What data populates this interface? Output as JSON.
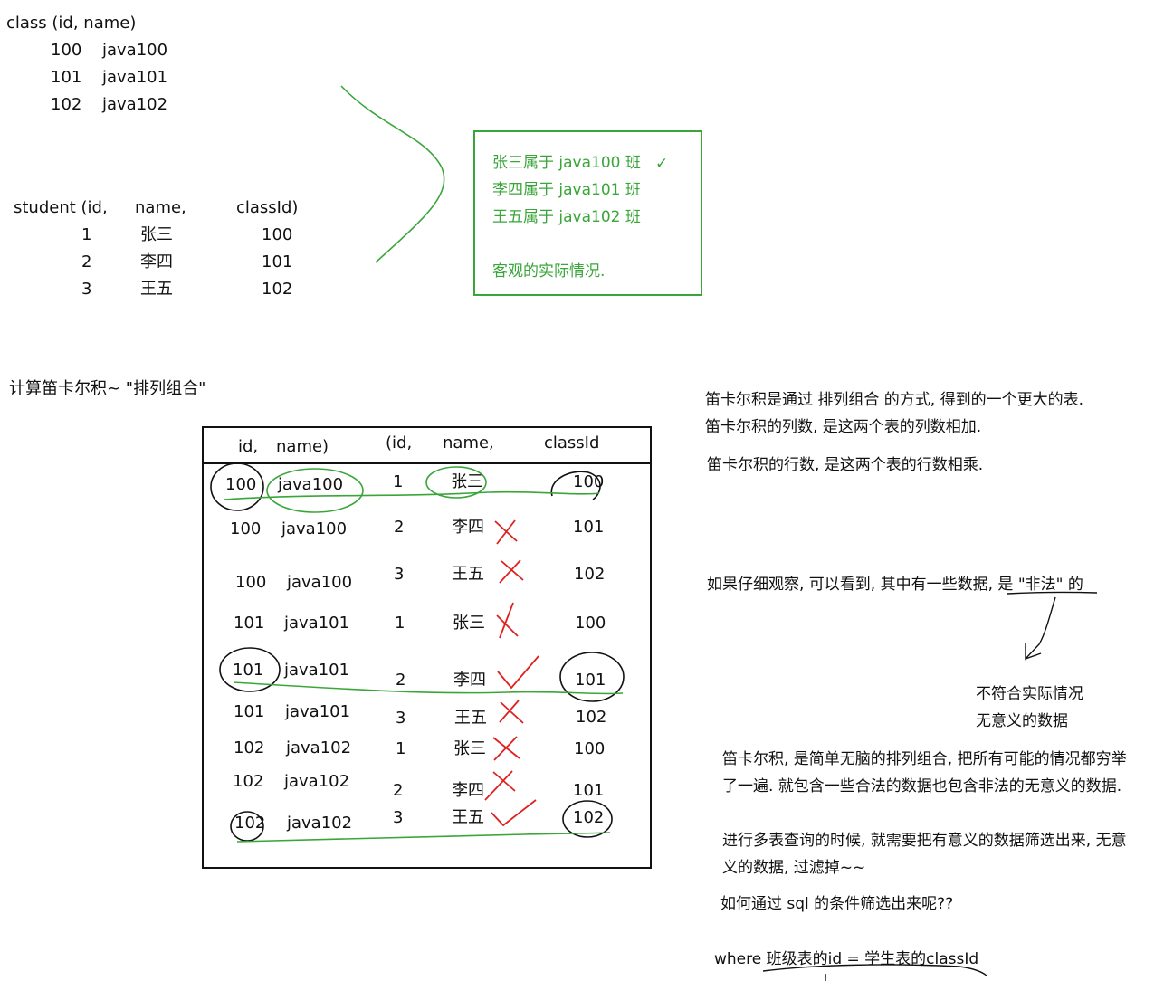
{
  "class_table": {
    "header": "class (id,     name)",
    "rows": [
      {
        "id": "100",
        "name": "java100"
      },
      {
        "id": "101",
        "name": "java101"
      },
      {
        "id": "102",
        "name": "java102"
      }
    ]
  },
  "student_table": {
    "header": "student (id,",
    "header_name": "name,",
    "header_classid": "classId)",
    "rows": [
      {
        "id": "1",
        "name": "张三",
        "classId": "100"
      },
      {
        "id": "2",
        "name": "李四",
        "classId": "101"
      },
      {
        "id": "3",
        "name": "王五",
        "classId": "102"
      }
    ]
  },
  "relation_box": {
    "lines": [
      "张三属于 java100 班",
      "李四属于 java101 班",
      "王五属于 java102 班"
    ],
    "checkmark": "✓",
    "footer": "客观的实际情况."
  },
  "section_title": "计算笛卡尔积~ \"排列组合\"",
  "product_table": {
    "headers": [
      "id,",
      "name)",
      "(id,",
      "name,",
      "classId"
    ],
    "rows": [
      {
        "cid": "100",
        "cname": "java100",
        "sid": "1",
        "sname": "张三",
        "classId": "100",
        "mark": "valid"
      },
      {
        "cid": "100",
        "cname": "java100",
        "sid": "2",
        "sname": "李四",
        "classId": "101",
        "mark": "invalid"
      },
      {
        "cid": "100",
        "cname": "java100",
        "sid": "3",
        "sname": "王五",
        "classId": "102",
        "mark": "invalid"
      },
      {
        "cid": "101",
        "cname": "java101",
        "sid": "1",
        "sname": "张三",
        "classId": "100",
        "mark": "invalid"
      },
      {
        "cid": "101",
        "cname": "java101",
        "sid": "2",
        "sname": "李四",
        "classId": "101",
        "mark": "valid"
      },
      {
        "cid": "101",
        "cname": "java101",
        "sid": "3",
        "sname": "王五",
        "classId": "102",
        "mark": "invalid"
      },
      {
        "cid": "102",
        "cname": "java102",
        "sid": "1",
        "sname": "张三",
        "classId": "100",
        "mark": "invalid"
      },
      {
        "cid": "102",
        "cname": "java102",
        "sid": "2",
        "sname": "李四",
        "classId": "101",
        "mark": "invalid"
      },
      {
        "cid": "102",
        "cname": "java102",
        "sid": "3",
        "sname": "王五",
        "classId": "102",
        "mark": "valid"
      }
    ]
  },
  "notes": {
    "p1_line1": "笛卡尔积是通过 排列组合 的方式, 得到的一个更大的表.",
    "p1_line2": "笛卡尔积的列数, 是这两个表的列数相加.",
    "p2": "笛卡尔积的行数, 是这两个表的行数相乘.",
    "p3": "如果仔细观察, 可以看到, 其中有一些数据, 是 \"非法\" 的",
    "p4_line1": "不符合实际情况",
    "p4_line2": "无意义的数据",
    "p5_line1": "笛卡尔积, 是简单无脑的排列组合, 把所有可能的情况都穷举",
    "p5_line2": "了一遍. 就包含一些合法的数据也包含非法的无意义的数据.",
    "p6_line1": "进行多表查询的时候, 就需要把有意义的数据筛选出来, 无意",
    "p6_line2": "义的数据, 过滤掉~~",
    "p7": "如何通过 sql 的条件筛选出来呢??",
    "p8": "where 班级表的id = 学生表的classId"
  },
  "colors": {
    "green": "#3aa63a",
    "red": "#e02020",
    "ink": "#111111"
  }
}
